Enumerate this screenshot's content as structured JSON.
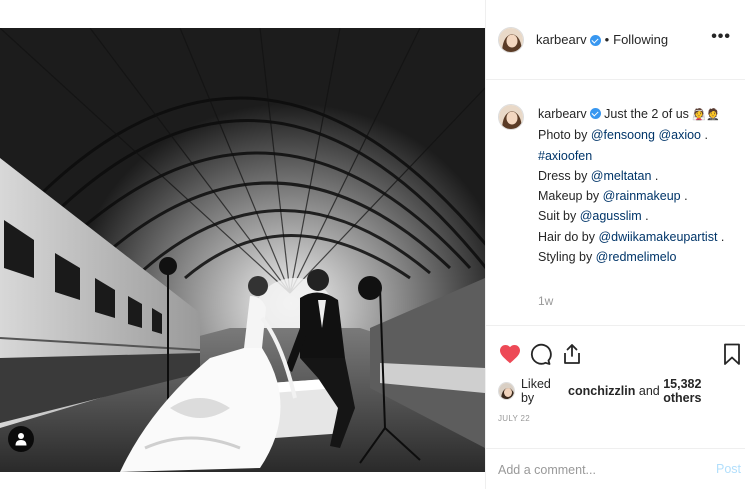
{
  "post": {
    "username": "karbearv",
    "follow_status": "Following",
    "separator": "•",
    "more_label": "•••",
    "caption": {
      "username": "karbearv",
      "text": "Just the 2 of us",
      "emoji": "👰🤵",
      "lines": {
        "photo_prefix": "Photo by ",
        "photo_mention_1": "@fensoong",
        "photo_mention_2": "@axioo",
        "photo_suffix": " .",
        "hashtag": "#axioofen",
        "dress_prefix": "Dress by ",
        "dress_mention": "@meltatan",
        "dress_suffix": " .",
        "makeup_prefix": "Makeup by ",
        "makeup_mention": "@rainmakeup",
        "makeup_suffix": " .",
        "suit_prefix": "Suit by ",
        "suit_mention": "@agusslim",
        "suit_suffix": " .",
        "hair_prefix": "Hair do by ",
        "hair_mention": "@dwiikamakeupartist",
        "hair_suffix": " .",
        "styling_prefix": "Styling by ",
        "styling_mention": "@redmelimelo"
      },
      "time_ago": "1w"
    },
    "likes": {
      "prefix": "Liked by ",
      "user": "conchizzlin",
      "connector": " and ",
      "others": "15,382 others"
    },
    "date": "JULY 22",
    "comment": {
      "placeholder": "Add a comment...",
      "post_label": "Post"
    },
    "icons": {
      "like": "heart-icon-filled",
      "comment": "comment-icon",
      "share": "share-icon",
      "save": "bookmark-icon",
      "tag": "user-tag-icon"
    },
    "colors": {
      "like_red": "#ed4956",
      "mention_blue": "#003569",
      "verified_blue": "#3897f0",
      "post_disabled": "#b2dffc",
      "muted_gray": "#999999"
    }
  }
}
